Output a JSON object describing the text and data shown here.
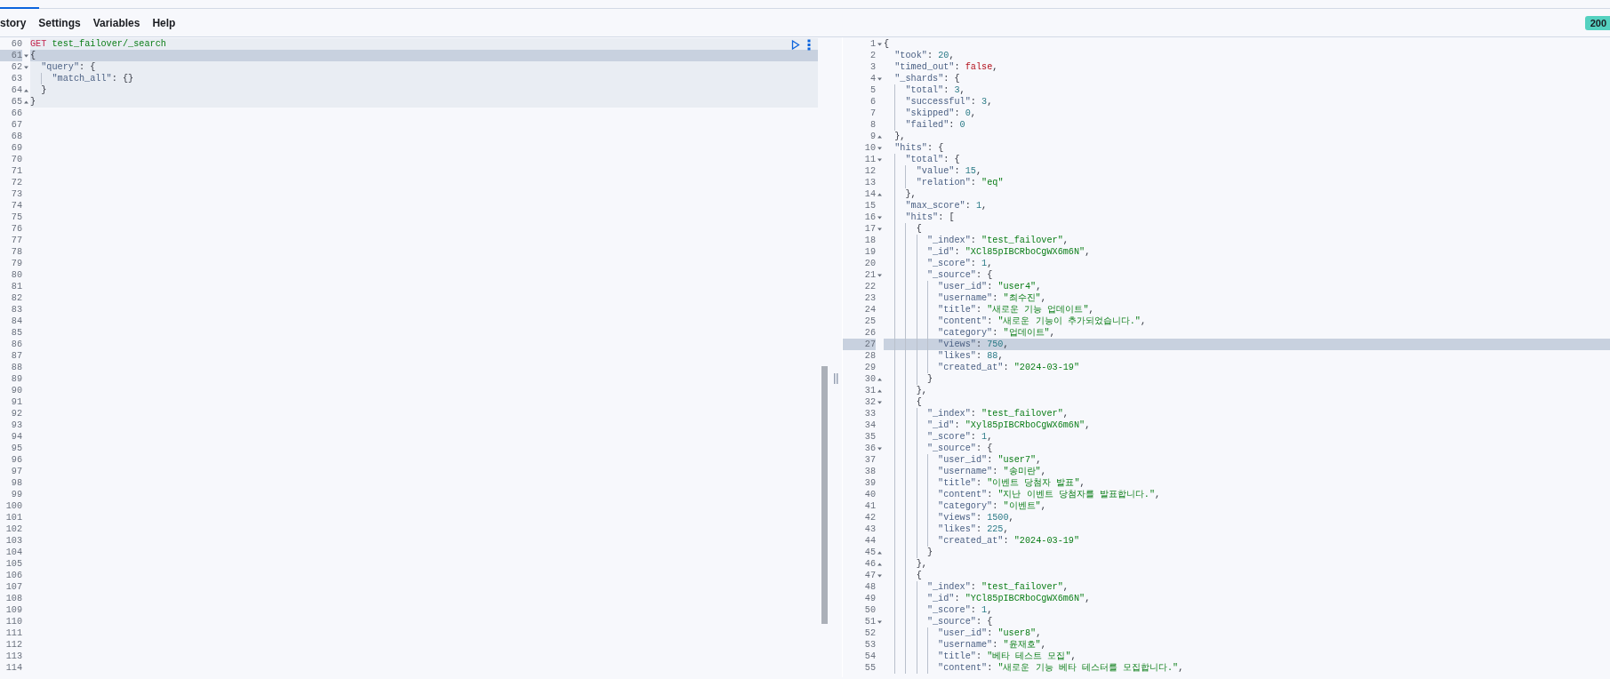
{
  "menu": [
    {
      "label": "story"
    },
    {
      "label": "Settings"
    },
    {
      "label": "Variables"
    },
    {
      "label": "Help"
    }
  ],
  "status_badge": "200",
  "request": {
    "method": "GET",
    "path": "test_failover/_search",
    "number": "60",
    "active": false,
    "lines": [
      {
        "number": "61",
        "fold_start": true,
        "code": "{",
        "active": true
      },
      {
        "number": "62",
        "fold_start": true,
        "code": "  \"query\": {",
        "active": false
      },
      {
        "number": "63",
        "code": "    \"match_all\": {}",
        "active": false
      },
      {
        "number": "64",
        "fold_end": true,
        "code": "  }",
        "active": false
      },
      {
        "number": "65",
        "fold_end": true,
        "code": "}",
        "active": false
      }
    ]
  },
  "empty_lines": [
    "66",
    "67",
    "68",
    "69",
    "70",
    "71",
    "72",
    "73",
    "74",
    "75",
    "76",
    "77",
    "78",
    "79",
    "80",
    "81",
    "82",
    "83",
    "84",
    "85",
    "86",
    "87",
    "88",
    "89",
    "90",
    "91",
    "92",
    "93",
    "94",
    "95",
    "96",
    "97",
    "98",
    "99",
    "100",
    "101",
    "102",
    "103",
    "104",
    "105",
    "106",
    "107",
    "108",
    "109",
    "110",
    "111",
    "112",
    "113",
    "114"
  ],
  "response": {
    "lines": [
      {
        "number": "1",
        "fold_start": true,
        "code": "{",
        "active": false
      },
      {
        "number": "2",
        "code": "  \"took\": 20,",
        "active": false
      },
      {
        "number": "3",
        "code": "  \"timed_out\": false,",
        "active": false
      },
      {
        "number": "4",
        "fold_start": true,
        "code": "  \"_shards\": {",
        "active": false
      },
      {
        "number": "5",
        "code": "    \"total\": 3,",
        "active": false
      },
      {
        "number": "6",
        "code": "    \"successful\": 3,",
        "active": false
      },
      {
        "number": "7",
        "code": "    \"skipped\": 0,",
        "active": false
      },
      {
        "number": "8",
        "code": "    \"failed\": 0",
        "active": false
      },
      {
        "number": "9",
        "fold_end": true,
        "code": "  },",
        "active": false
      },
      {
        "number": "10",
        "fold_start": true,
        "code": "  \"hits\": {",
        "active": false
      },
      {
        "number": "11",
        "fold_start": true,
        "code": "    \"total\": {",
        "active": false
      },
      {
        "number": "12",
        "code": "      \"value\": 15,",
        "active": false
      },
      {
        "number": "13",
        "code": "      \"relation\": \"eq\"",
        "active": false
      },
      {
        "number": "14",
        "fold_end": true,
        "code": "    },",
        "active": false
      },
      {
        "number": "15",
        "code": "    \"max_score\": 1,",
        "active": false
      },
      {
        "number": "16",
        "fold_start": true,
        "code": "    \"hits\": [",
        "active": false
      },
      {
        "number": "17",
        "fold_start": true,
        "code": "      {",
        "active": false
      },
      {
        "number": "18",
        "code": "        \"_index\": \"test_failover\",",
        "active": false
      },
      {
        "number": "19",
        "code": "        \"_id\": \"XCl85pIBCRboCgWX6m6N\",",
        "active": false
      },
      {
        "number": "20",
        "code": "        \"_score\": 1,",
        "active": false
      },
      {
        "number": "21",
        "fold_start": true,
        "code": "        \"_source\": {",
        "active": false
      },
      {
        "number": "22",
        "code": "          \"user_id\": \"user4\",",
        "active": false
      },
      {
        "number": "23",
        "code": "          \"username\": \"최수진\",",
        "active": false
      },
      {
        "number": "24",
        "code": "          \"title\": \"새로운 기능 업데이트\",",
        "active": false
      },
      {
        "number": "25",
        "code": "          \"content\": \"새로운 기능이 추가되었습니다.\",",
        "active": false
      },
      {
        "number": "26",
        "code": "          \"category\": \"업데이트\",",
        "active": false
      },
      {
        "number": "27",
        "code": "          \"views\": 750,",
        "active": true
      },
      {
        "number": "28",
        "code": "          \"likes\": 88,",
        "active": false
      },
      {
        "number": "29",
        "code": "          \"created_at\": \"2024-03-19\"",
        "active": false
      },
      {
        "number": "30",
        "fold_end": true,
        "code": "        }",
        "active": false
      },
      {
        "number": "31",
        "fold_end": true,
        "code": "      },",
        "active": false
      },
      {
        "number": "32",
        "fold_start": true,
        "code": "      {",
        "active": false
      },
      {
        "number": "33",
        "code": "        \"_index\": \"test_failover\",",
        "active": false
      },
      {
        "number": "34",
        "code": "        \"_id\": \"Xyl85pIBCRboCgWX6m6N\",",
        "active": false
      },
      {
        "number": "35",
        "code": "        \"_score\": 1,",
        "active": false
      },
      {
        "number": "36",
        "fold_start": true,
        "code": "        \"_source\": {",
        "active": false
      },
      {
        "number": "37",
        "code": "          \"user_id\": \"user7\",",
        "active": false
      },
      {
        "number": "38",
        "code": "          \"username\": \"송미란\",",
        "active": false
      },
      {
        "number": "39",
        "code": "          \"title\": \"이벤트 당첨자 발표\",",
        "active": false
      },
      {
        "number": "40",
        "code": "          \"content\": \"지난 이벤트 당첨자를 발표합니다.\",",
        "active": false
      },
      {
        "number": "41",
        "code": "          \"category\": \"이벤트\",",
        "active": false
      },
      {
        "number": "42",
        "code": "          \"views\": 1500,",
        "active": false
      },
      {
        "number": "43",
        "code": "          \"likes\": 225,",
        "active": false
      },
      {
        "number": "44",
        "code": "          \"created_at\": \"2024-03-19\"",
        "active": false
      },
      {
        "number": "45",
        "fold_end": true,
        "code": "        }",
        "active": false
      },
      {
        "number": "46",
        "fold_end": true,
        "code": "      },",
        "active": false
      },
      {
        "number": "47",
        "fold_start": true,
        "code": "      {",
        "active": false
      },
      {
        "number": "48",
        "code": "        \"_index\": \"test_failover\",",
        "active": false
      },
      {
        "number": "49",
        "code": "        \"_id\": \"YCl85pIBCRboCgWX6m6N\",",
        "active": false
      },
      {
        "number": "50",
        "code": "        \"_score\": 1,",
        "active": false
      },
      {
        "number": "51",
        "fold_start": true,
        "code": "        \"_source\": {",
        "active": false
      },
      {
        "number": "52",
        "code": "          \"user_id\": \"user8\",",
        "active": false
      },
      {
        "number": "53",
        "code": "          \"username\": \"윤재호\",",
        "active": false
      },
      {
        "number": "54",
        "code": "          \"title\": \"베타 테스트 모집\",",
        "active": false
      },
      {
        "number": "55",
        "code": "          \"content\": \"새로운 기능 베타 테스터를 모집합니다.\",",
        "active": false
      }
    ]
  }
}
